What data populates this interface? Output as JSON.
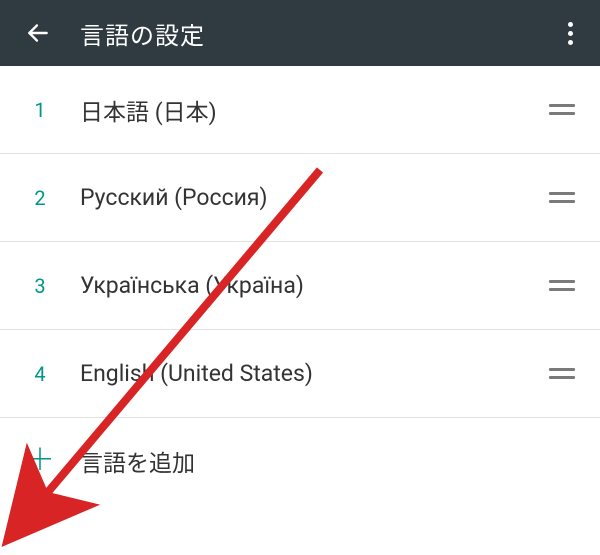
{
  "header": {
    "title": "言語の設定"
  },
  "languages": [
    {
      "index": "1",
      "label": "日本語 (日本)"
    },
    {
      "index": "2",
      "label": "Русский (Россия)"
    },
    {
      "index": "3",
      "label": "Українська (Україна)"
    },
    {
      "index": "4",
      "label": "English (United States)"
    }
  ],
  "add_language_label": "言語を追加",
  "colors": {
    "appbar_bg": "#2f3b41",
    "accent": "#009688",
    "arrow": "#d82424"
  }
}
